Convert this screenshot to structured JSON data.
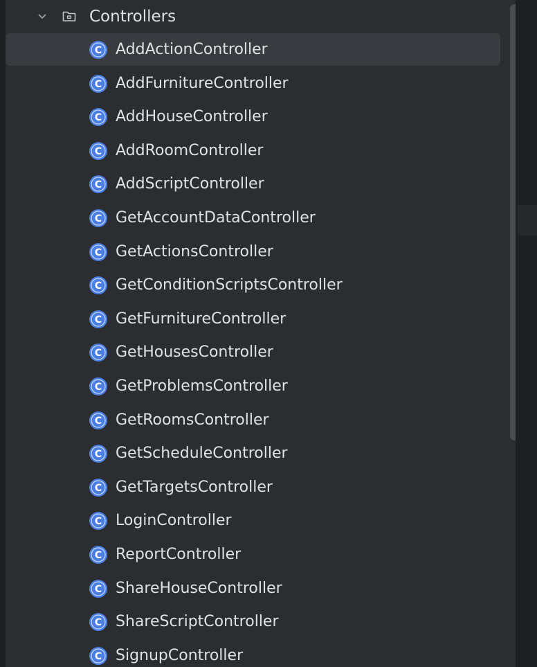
{
  "project_tree": {
    "folder": {
      "label": "Controllers",
      "expanded": true,
      "chevron_icon": "chevron-down-icon",
      "folder_icon": "folder-icon"
    },
    "selected_index": 0,
    "items": [
      {
        "label": "AddActionController",
        "icon": "class-icon"
      },
      {
        "label": "AddFurnitureController",
        "icon": "class-icon"
      },
      {
        "label": "AddHouseController",
        "icon": "class-icon"
      },
      {
        "label": "AddRoomController",
        "icon": "class-icon"
      },
      {
        "label": "AddScriptController",
        "icon": "class-icon"
      },
      {
        "label": "GetAccountDataController",
        "icon": "class-icon"
      },
      {
        "label": "GetActionsController",
        "icon": "class-icon"
      },
      {
        "label": "GetConditionScriptsController",
        "icon": "class-icon"
      },
      {
        "label": "GetFurnitureController",
        "icon": "class-icon"
      },
      {
        "label": "GetHousesController",
        "icon": "class-icon"
      },
      {
        "label": "GetProblemsController",
        "icon": "class-icon"
      },
      {
        "label": "GetRoomsController",
        "icon": "class-icon"
      },
      {
        "label": "GetScheduleController",
        "icon": "class-icon"
      },
      {
        "label": "GetTargetsController",
        "icon": "class-icon"
      },
      {
        "label": "LoginController",
        "icon": "class-icon"
      },
      {
        "label": "ReportController",
        "icon": "class-icon"
      },
      {
        "label": "ShareHouseController",
        "icon": "class-icon"
      },
      {
        "label": "ShareScriptController",
        "icon": "class-icon"
      },
      {
        "label": "SignupController",
        "icon": "class-icon"
      }
    ]
  },
  "colors": {
    "panel_background": "#2b2d30",
    "selection_background": "#393b40",
    "text": "#dfe1e5",
    "class_icon": "#4a7ee3"
  }
}
